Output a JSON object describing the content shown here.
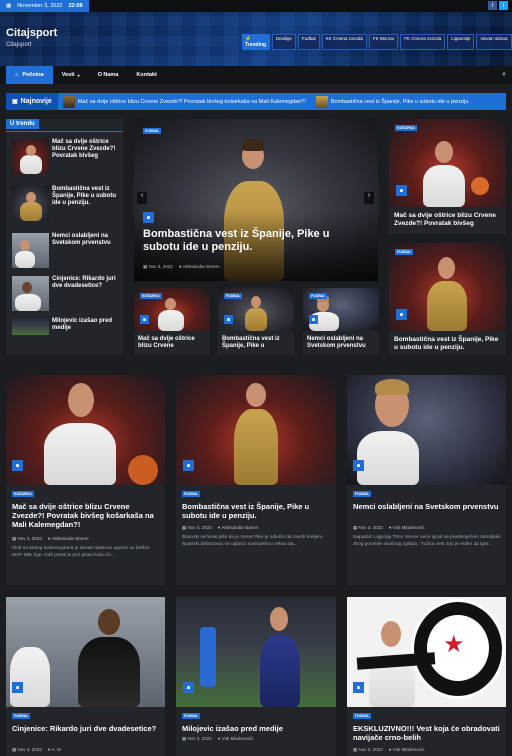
{
  "topbar": {
    "date": "November 3, 2022",
    "time": "22:08"
  },
  "header": {
    "title": "Citajsport",
    "subtitle": "Citajsport"
  },
  "trending": {
    "label": "Trending",
    "tags": [
      "Desilige",
      "Fudbal",
      "KK Crvena zvezda",
      "FK Mornar",
      "FK Crvena zvezda",
      "Ligavrstje",
      "stevan stimac"
    ]
  },
  "nav": {
    "items": [
      "Početna",
      "Vesti",
      "O Nama",
      "Kontakt"
    ]
  },
  "ticker": {
    "label": "Najnovije",
    "items": [
      "Mač sa dvije oštrice blizu Crvene Zvezde?! Povratak bivšeg košarkaša na Mali Kalemegdan?!",
      "Bombastična vest iz Španije, Pike u subotu ide u penziju."
    ]
  },
  "sidebar": {
    "title": "U trendu",
    "items": [
      "Mač sa dvije oštrice blizu Crvene Zvezde?! Povratak bivšeg",
      "Bombastična vest iz Španije, Pike u subotu ide u penziju.",
      "Nemci oslabljeni na Svetskom prvenstvu",
      "Cinjenice: Rikardo juri dve dvadesetice?",
      "Milojevic izašao pred medije"
    ]
  },
  "hero": {
    "badge": "Fudbal",
    "title": "Bombastična vest iz Španije, Pike u subotu ide u penziju.",
    "date": "Nov 3, 2022",
    "author": "Aleksandar Barem"
  },
  "small_cards": [
    {
      "badge": "Košarka",
      "title": "Mač sa dvije oštrice blizu Crvene"
    },
    {
      "badge": "Fudbal",
      "title": "Bombastična vest iz Španije, Pike u"
    },
    {
      "badge": "Fudbal",
      "title": "Nemci oslabljeni na Svetskom prvenstvu"
    }
  ],
  "right_cards": [
    {
      "badge": "Košarka",
      "title": "Mač sa dvije oštrice blizu Crvene Zvezde?! Povratak bivšeg"
    },
    {
      "badge": "Fudbal",
      "title": "Bombastična vest iz Španije, Pike u subotu ide u penziju."
    }
  ],
  "grid_row1": [
    {
      "badge": "Košarka",
      "title": "Mač sa dvije oštrice blizu Crvene Zvezde?! Povratak bivšeg košarkaša na Mali Kalemegdan?!",
      "date": "Nov 3, 2022",
      "author": "Aleksandar Barem",
      "excerpt": "Klub sa Malog Kalemegdana je danas raskinuo ugovor sa bivšim MVP NBL lige. Naš portal je prvi pisao kako će..."
    },
    {
      "badge": "Fudbal",
      "title": "Bombastična vest iz Španije, Pike u subotu ide u penziju.",
      "date": "Nov 3, 2022",
      "author": "Aleksandar Barem",
      "excerpt": "Španski večeras piše da je Gerar Pike je odlučio da završi karijeru. Španski defanzivac se oglasio novinarima i rekao da..."
    },
    {
      "badge": "Fudbal",
      "title": "Nemci oslabljeni na Svetskom prvenstvu",
      "date": "Nov 3, 2022",
      "author": "Vuk Mladenović",
      "excerpt": "Napadač Lajpciga Timo Verner neće igrati na predstojećem Mundijalu zbog povrede skočnog zglaba. \"Tužna vest, bio je ređen da igra..."
    }
  ],
  "grid_row2": [
    {
      "badge": "Fudbal",
      "title": "Cinjenice: Rikardo juri dve dvadesetice?",
      "date": "Nov 3, 2022",
      "author": "A. M"
    },
    {
      "badge": "Fudbal",
      "title": "Milojevic izašao pred medije",
      "date": "Nov 3, 2022",
      "author": "Vuk Mladenović"
    },
    {
      "badge": "Fudbal",
      "title": "EKSKLUZIVNO!!! Vest koja će obradovati navijače crno-belih",
      "date": "Nov 2, 2022",
      "author": "Vuk Mladenović"
    }
  ],
  "colors": {
    "accent": "#1f6fd6",
    "background": "#1b1d21",
    "card": "#22252a"
  }
}
